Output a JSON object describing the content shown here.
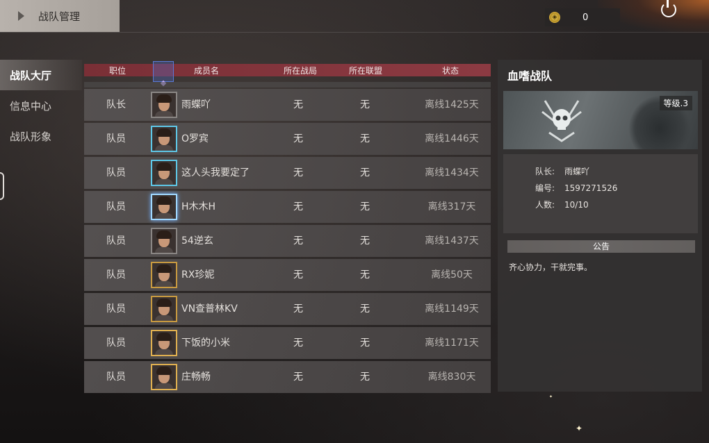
{
  "header": {
    "title": "战队管理",
    "currency_amount": "0"
  },
  "sidebar": {
    "items": [
      {
        "label": "战队大厅",
        "active": true
      },
      {
        "label": "信息中心",
        "active": false
      },
      {
        "label": "战队形象",
        "active": false
      }
    ]
  },
  "table": {
    "columns": [
      "职位",
      "成员名",
      "所在战局",
      "所在联盟",
      "状态"
    ],
    "rows": [
      {
        "role": "队长",
        "name": "雨蝶吖",
        "battle": "无",
        "alliance": "无",
        "status": "离线1425天",
        "frame": "plain"
      },
      {
        "role": "队员",
        "name": "O罗宾",
        "battle": "无",
        "alliance": "无",
        "status": "离线1446天",
        "frame": "blue"
      },
      {
        "role": "队员",
        "name": "这人头我要定了",
        "battle": "无",
        "alliance": "无",
        "status": "离线1434天",
        "frame": "blue"
      },
      {
        "role": "队员",
        "name": "H木木H",
        "battle": "无",
        "alliance": "无",
        "status": "离线317天",
        "frame": "ice"
      },
      {
        "role": "队员",
        "name": "54逆玄",
        "battle": "无",
        "alliance": "无",
        "status": "离线1437天",
        "frame": "plain"
      },
      {
        "role": "队员",
        "name": "RX珍妮",
        "battle": "无",
        "alliance": "无",
        "status": "离线50天",
        "frame": "gold"
      },
      {
        "role": "队员",
        "name": "VN查普林KV",
        "battle": "无",
        "alliance": "无",
        "status": "离线1149天",
        "frame": "gold"
      },
      {
        "role": "队员",
        "name": "下饭的小米",
        "battle": "无",
        "alliance": "无",
        "status": "离线1171天",
        "frame": "gold2"
      },
      {
        "role": "队员",
        "name": "庄畅畅",
        "battle": "无",
        "alliance": "无",
        "status": "离线830天",
        "frame": "gold2"
      }
    ]
  },
  "team": {
    "name": "血嗜战队",
    "level": "等级.3",
    "leader_label": "队长:",
    "leader": "雨蝶吖",
    "id_label": "编号:",
    "id": "1597271526",
    "count_label": "人数:",
    "count": "10/10",
    "notice_title": "公告",
    "notice": "齐心协力，干就完事。"
  }
}
